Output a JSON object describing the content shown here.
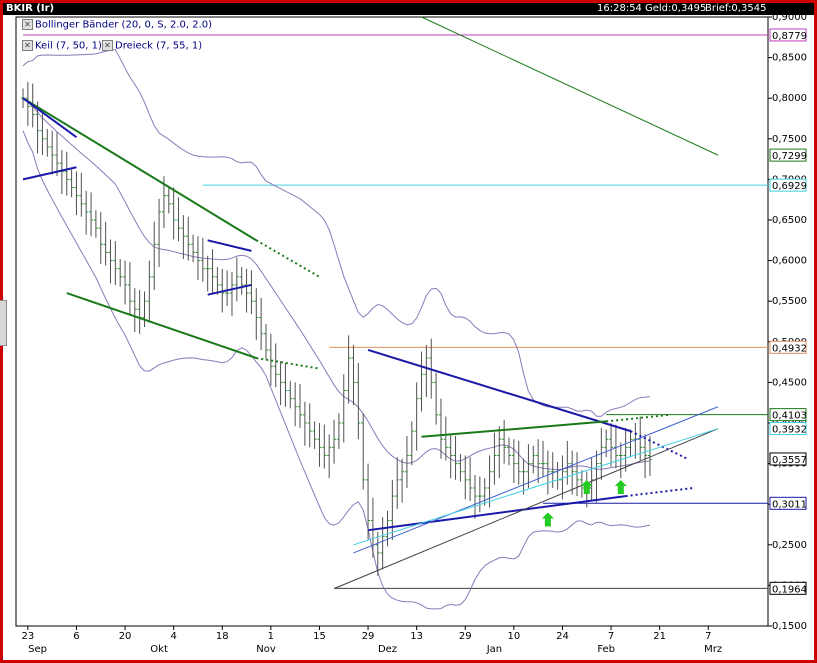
{
  "header": {
    "symbol": "BKIR (Ir)",
    "time": "16:28:54",
    "bid": "Geld:0,3495",
    "ask": "Brief:0,3545"
  },
  "indicators": [
    {
      "label": "Bollinger Bänder (20, 0, S, 2.0, 2.0)"
    },
    {
      "label": "Keil (7, 50, 1)"
    },
    {
      "label": "Dreieck (7, 55, 1)"
    }
  ],
  "colors": {
    "price_up": "#2c8c2c",
    "price_down": "#2c8c2c",
    "bollinger": "#8a7ab8",
    "trend_green": "#1a7a1a",
    "trend_blue": "#1a1aaa",
    "cyan_line": "#40d0e0",
    "orange_line": "#e09060",
    "magenta_line": "#c040c0",
    "arrow": "#22cc22"
  },
  "chart_data": {
    "type": "candlestick",
    "y_axis_ticks": [
      "0,9000",
      "0,8500",
      "0,8000",
      "0,7500",
      "0,7000",
      "0,6500",
      "0,6000",
      "0,5500",
      "0,5000",
      "0,4500",
      "0,4000",
      "0,3500",
      "0,3000",
      "0,2500",
      "0,2000",
      "0,1500"
    ],
    "y_tick_values": [
      0.9,
      0.85,
      0.8,
      0.75,
      0.7,
      0.65,
      0.6,
      0.55,
      0.5,
      0.45,
      0.4,
      0.35,
      0.3,
      0.25,
      0.2,
      0.15
    ],
    "ylim": [
      0.15,
      0.9
    ],
    "x_tick_labels": [
      "23",
      "6",
      "20",
      "4",
      "18",
      "1",
      "15",
      "29",
      "13",
      "29",
      "10",
      "24",
      "7",
      "21",
      "7"
    ],
    "x_tick_bars": [
      1,
      11,
      21,
      31,
      41,
      51,
      61,
      71,
      81,
      91,
      101,
      111,
      121,
      131,
      141
    ],
    "month_labels": [
      "Sep",
      "Okt",
      "Nov",
      "Dez",
      "Jan",
      "Feb",
      "Mrz"
    ],
    "month_label_bars": [
      3,
      28,
      50,
      75,
      97,
      120,
      142
    ],
    "price_labels": [
      {
        "text": "0,8779",
        "value": 0.8779,
        "color": "#c040c0"
      },
      {
        "text": "0,7299",
        "value": 0.7299,
        "color": "#1a7a1a"
      },
      {
        "text": "0,6929",
        "value": 0.6929,
        "color": "#40d0e0"
      },
      {
        "text": "0,4932",
        "value": 0.4932,
        "color": "#e09060"
      },
      {
        "text": "0,4103",
        "value": 0.4103,
        "color": "#1a7a1a"
      },
      {
        "text": "0,3932",
        "value": 0.3932,
        "color": "#40d0e0"
      },
      {
        "text": "0,3557",
        "value": 0.3557,
        "color": "#000000"
      },
      {
        "text": "0,3011",
        "value": 0.3011,
        "color": "#1a1aaa"
      },
      {
        "text": "0,1964",
        "value": 0.1964,
        "color": "#000000"
      }
    ],
    "close_series": [
      0.8,
      0.79,
      0.78,
      0.76,
      0.75,
      0.74,
      0.73,
      0.72,
      0.71,
      0.7,
      0.69,
      0.68,
      0.67,
      0.66,
      0.65,
      0.64,
      0.62,
      0.61,
      0.6,
      0.59,
      0.58,
      0.57,
      0.55,
      0.54,
      0.53,
      0.55,
      0.58,
      0.62,
      0.66,
      0.68,
      0.67,
      0.65,
      0.64,
      0.63,
      0.62,
      0.61,
      0.6,
      0.59,
      0.59,
      0.58,
      0.57,
      0.56,
      0.56,
      0.57,
      0.58,
      0.57,
      0.56,
      0.55,
      0.53,
      0.51,
      0.49,
      0.47,
      0.46,
      0.45,
      0.44,
      0.43,
      0.42,
      0.41,
      0.4,
      0.39,
      0.38,
      0.37,
      0.36,
      0.37,
      0.38,
      0.4,
      0.44,
      0.48,
      0.45,
      0.4,
      0.33,
      0.28,
      0.25,
      0.24,
      0.26,
      0.28,
      0.31,
      0.33,
      0.34,
      0.36,
      0.39,
      0.43,
      0.46,
      0.48,
      0.45,
      0.41,
      0.38,
      0.37,
      0.36,
      0.35,
      0.34,
      0.33,
      0.32,
      0.31,
      0.31,
      0.32,
      0.34,
      0.36,
      0.38,
      0.37,
      0.36,
      0.35,
      0.34,
      0.34,
      0.35,
      0.36,
      0.35,
      0.35,
      0.34,
      0.34,
      0.33,
      0.34,
      0.35,
      0.34,
      0.33,
      0.32,
      0.32,
      0.33,
      0.35,
      0.37,
      0.38,
      0.37,
      0.36,
      0.36,
      0.37,
      0.38,
      0.38,
      0.37,
      0.36,
      0.355
    ],
    "lines": [
      {
        "name": "wedge-top-left",
        "color": "#1a7a1a",
        "points": [
          [
            0,
            0.8
          ],
          [
            48,
            0.625
          ]
        ],
        "dotted_to": [
          61,
          0.58
        ]
      },
      {
        "name": "wedge-bottom-left",
        "color": "#1a7a1a",
        "points": [
          [
            9,
            0.56
          ],
          [
            48,
            0.48
          ]
        ],
        "dotted_to": [
          61,
          0.467
        ]
      },
      {
        "name": "blue-flag-left-top",
        "color": "#1a1aaa",
        "points": [
          [
            0,
            0.8
          ],
          [
            11,
            0.752
          ]
        ]
      },
      {
        "name": "blue-flag-left-bottom",
        "color": "#1a1aaa",
        "points": [
          [
            0,
            0.7
          ],
          [
            11,
            0.715
          ]
        ]
      },
      {
        "name": "blue-flag-mid-top",
        "color": "#1a1aaa",
        "points": [
          [
            38,
            0.625
          ],
          [
            47,
            0.612
          ]
        ]
      },
      {
        "name": "blue-flag-mid-bottom",
        "color": "#1a1aaa",
        "points": [
          [
            38,
            0.558
          ],
          [
            47,
            0.57
          ]
        ]
      },
      {
        "name": "green-long-falling",
        "color": "#1a7a1a",
        "points": [
          [
            82,
            0.9
          ],
          [
            143,
            0.7299
          ]
        ]
      },
      {
        "name": "triangle-top",
        "color": "#1a1aaa",
        "points": [
          [
            71,
            0.49
          ],
          [
            125,
            0.39
          ]
        ],
        "dotted_to": [
          137,
          0.355
        ]
      },
      {
        "name": "triangle-bottom",
        "color": "#1a1aaa",
        "points": [
          [
            71,
            0.268
          ],
          [
            124,
            0.31
          ]
        ],
        "dotted_to": [
          138,
          0.32
        ]
      },
      {
        "name": "green-upper",
        "color": "#1a7a1a",
        "points": [
          [
            82,
            0.383
          ],
          [
            120,
            0.402
          ]
        ],
        "dotted_to": [
          133,
          0.41
        ]
      },
      {
        "name": "gray-trend-long",
        "color": "#404040",
        "points": [
          [
            64,
            0.196
          ],
          [
            143,
            0.393
          ]
        ]
      },
      {
        "name": "blue-channel-thin",
        "color": "#4060d0",
        "points": [
          [
            68,
            0.24
          ],
          [
            143,
            0.42
          ]
        ]
      },
      {
        "name": "cyan-channel",
        "color": "#40d0e0",
        "points": [
          [
            68,
            0.25
          ],
          [
            143,
            0.393
          ]
        ]
      }
    ],
    "horizontal_levels": [
      {
        "value": 0.8779,
        "from": 0,
        "color": "#c040c0"
      },
      {
        "value": 0.6929,
        "from": 37,
        "color": "#40d0e0"
      },
      {
        "value": 0.4932,
        "from": 63,
        "color": "#e09060"
      },
      {
        "value": 0.4103,
        "from": 120,
        "color": "#1a7a1a"
      },
      {
        "value": 0.3011,
        "from": 107,
        "color": "#1a1aaa"
      },
      {
        "value": 0.1964,
        "from": 64,
        "color": "#404040"
      }
    ],
    "arrows": [
      {
        "bar": 108,
        "value": 0.28
      },
      {
        "bar": 116,
        "value": 0.32
      },
      {
        "bar": 123,
        "value": 0.32
      }
    ]
  }
}
